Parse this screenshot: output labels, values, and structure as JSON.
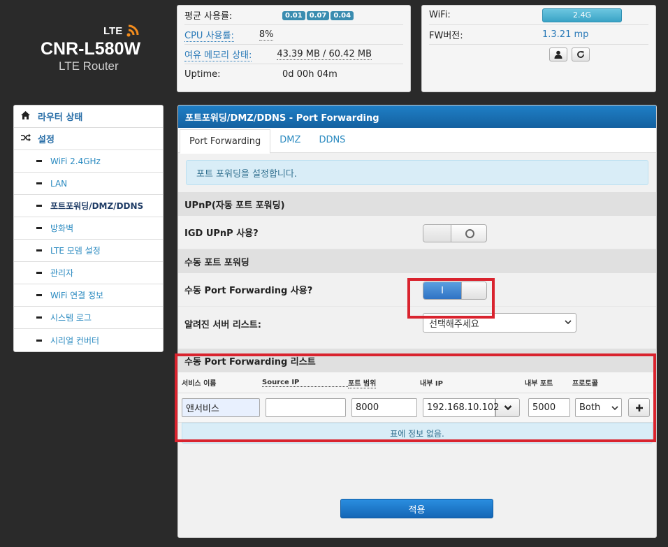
{
  "logo": {
    "lte": "LTE",
    "model": "CNR-L580W",
    "sub": "LTE Router"
  },
  "status": {
    "load_label": "평균 사용률:",
    "load_values": [
      "0.01",
      "0.07",
      "0.04"
    ],
    "cpu_label": "CPU 사용률:",
    "cpu_value": "8%",
    "mem_label": "여유 메모리 상태:",
    "mem_value": "43.39 MB / 60.42 MB",
    "uptime_label": "Uptime:",
    "uptime_value": "0d 00h 04m"
  },
  "status2": {
    "wifi_label": "WiFi:",
    "wifi_value": "2.4G",
    "fw_label": "FW버전:",
    "fw_value": "1.3.21 mp"
  },
  "sidebar": {
    "items": [
      {
        "label": "라우터 상태",
        "type": "top",
        "icon": "home-icon"
      },
      {
        "label": "설정",
        "type": "top",
        "icon": "shuffle-icon"
      },
      {
        "label": "WiFi 2.4GHz",
        "type": "sub"
      },
      {
        "label": "LAN",
        "type": "sub"
      },
      {
        "label": "포트포워딩/DMZ/DDNS",
        "type": "sub",
        "active": true
      },
      {
        "label": "방화벽",
        "type": "sub"
      },
      {
        "label": "LTE 모뎀 설정",
        "type": "sub"
      },
      {
        "label": "관리자",
        "type": "sub"
      },
      {
        "label": "WiFi 연결 정보",
        "type": "sub"
      },
      {
        "label": "시스템 로그",
        "type": "sub"
      },
      {
        "label": "시리얼 컨버터",
        "type": "sub"
      }
    ]
  },
  "main": {
    "title": "포트포워딩/DMZ/DDNS - Port Forwarding",
    "tabs": [
      "Port Forwarding",
      "DMZ",
      "DDNS"
    ],
    "info": "포트 포워딩을 설정합니다.",
    "upnp_section": "UPnP(자동 포트 포워딩)",
    "igd_label": "IGD UPnP 사용?",
    "igd_toggle": "O",
    "manual_section": "수동 포트 포워딩",
    "manual_label": "수동 Port Forwarding 사용?",
    "manual_toggle": "I",
    "server_label": "알려진 서버 리스트:",
    "server_select": "선택해주세요",
    "list_section": "수동 Port Forwarding 리스트",
    "columns": [
      "서비스 이름",
      "Source IP",
      "포트 범위",
      "내부 IP",
      "내부 포트",
      "프로토콜"
    ],
    "row": {
      "service": "앤서비스",
      "source_ip": "",
      "port_range": "8000",
      "internal_ip": "192.168.10.102",
      "internal_port": "5000",
      "protocol": "Both"
    },
    "empty": "표에 정보 없음.",
    "apply": "적용"
  }
}
